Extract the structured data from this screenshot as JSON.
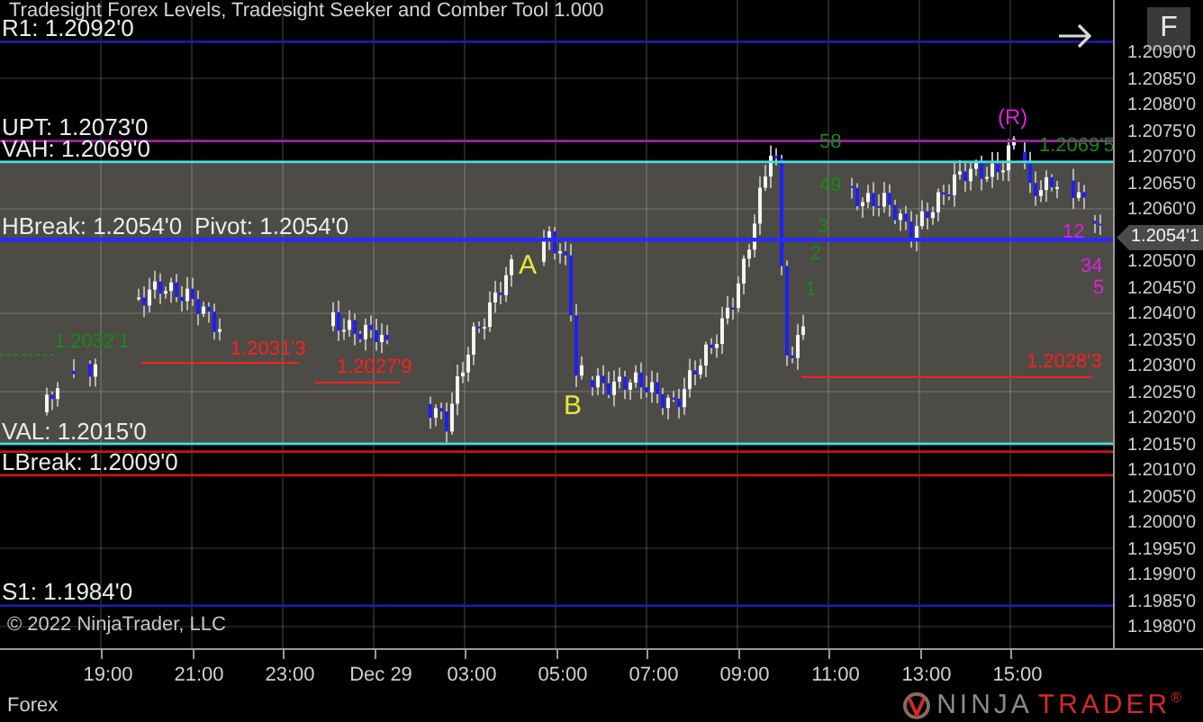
{
  "title": "Tradesight Forex Levels, Tradesight Seeker and Comber Tool 1.000",
  "levels": [
    {
      "label": "R1: 1.2092'0",
      "color": "#1c1ca8"
    },
    {
      "label": "UPT: 1.2073'0",
      "color": "#a020a0"
    },
    {
      "label": "VAH: 1.2069'0",
      "color": "#40e0e0"
    },
    {
      "label": "HBreak: 1.2054'0",
      "color": "#2a2aff"
    },
    {
      "label": "Pivot: 1.2054'0",
      "color": "#2a2aff"
    },
    {
      "label": "VAL: 1.2015'0",
      "color": "#40e0e0"
    },
    {
      "label": "LBreak: 1.2009'0",
      "color": "#c01818"
    },
    {
      "label": "S1: 1.1984'0",
      "color": "#1c1ca8"
    }
  ],
  "markers": [
    {
      "text": "(R)",
      "color": "#e020e0"
    },
    {
      "text": "58",
      "color": "#1a8a1a"
    },
    {
      "text": "1.2069'5",
      "color": "#1a8a1a"
    },
    {
      "text": "49",
      "color": "#1a8a1a"
    },
    {
      "text": "3",
      "color": "#1a8a1a"
    },
    {
      "text": "12",
      "color": "#e020e0"
    },
    {
      "text": "A",
      "color": "#e6e640"
    },
    {
      "text": "2",
      "color": "#1a8a1a"
    },
    {
      "text": "34",
      "color": "#e020e0"
    },
    {
      "text": "5",
      "color": "#e020e0"
    },
    {
      "text": "1",
      "color": "#1a8a1a"
    },
    {
      "text": "1.2032'1",
      "color": "#1a8a1a"
    },
    {
      "text": "1.2031'3",
      "color": "#ff2020"
    },
    {
      "text": "1.2027'9",
      "color": "#ff2020"
    },
    {
      "text": "1.2028'3",
      "color": "#ff2020"
    },
    {
      "text": "B",
      "color": "#e6e640"
    }
  ],
  "price_axis": [
    "1.2090'0",
    "1.2085'0",
    "1.2080'0",
    "1.2075'0",
    "1.2070'0",
    "1.2065'0",
    "1.2060'0",
    "1.2050'0",
    "1.2045'0",
    "1.2040'0",
    "1.2035'0",
    "1.2030'0",
    "1.2025'0",
    "1.2020'0",
    "1.2015'0",
    "1.2010'0",
    "1.2005'0",
    "1.2000'0",
    "1.1995'0",
    "1.1990'0",
    "1.1985'0",
    "1.1980'0"
  ],
  "current_price": "1.2054'1",
  "time_axis": [
    "19:00",
    "21:00",
    "23:00",
    "Dec 29",
    "03:00",
    "05:00",
    "07:00",
    "09:00",
    "11:00",
    "13:00",
    "15:00"
  ],
  "copyright": "© 2022 NinjaTrader, LLC",
  "panel_button": "F",
  "instrument": "Forex",
  "logo": {
    "left": "NINJA",
    "right": "TRADER",
    "mark": "®"
  }
}
